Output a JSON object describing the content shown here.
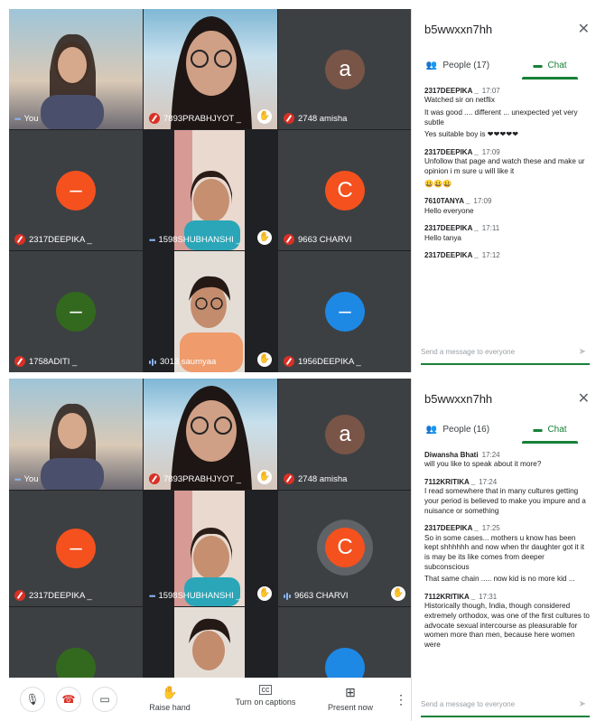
{
  "screen1": {
    "tiles": [
      {
        "name": "You",
        "indicator": "dots"
      },
      {
        "name": "7893PRABHJYOT _",
        "indicator": "mic-off"
      },
      {
        "name": "2748 amisha",
        "indicator": "mic-off",
        "avatar": "a",
        "avatar_color": "#795548"
      },
      {
        "name": "2317DEEPIKA _",
        "indicator": "mic-off",
        "avatar": "–",
        "avatar_color": "#f4511e"
      },
      {
        "name": "1598SHUBHANSHI _",
        "indicator": "dots"
      },
      {
        "name": "9663 CHARVI",
        "indicator": "mic-off",
        "avatar": "C",
        "avatar_color": "#f4511e"
      },
      {
        "name": "1758ADITI _",
        "indicator": "mic-off",
        "avatar": "–",
        "avatar_color": "#33691e"
      },
      {
        "name": "3013 saumyaa",
        "indicator": "bars"
      },
      {
        "name": "1956DEEPIKA _",
        "indicator": "mic-off",
        "avatar": "–",
        "avatar_color": "#1e88e5"
      }
    ],
    "panel": {
      "title": "b5wwxxn7hh",
      "people_tab": "People (17)",
      "chat_tab": "Chat",
      "messages": [
        {
          "sender": "2317DEEPIKA _",
          "time": "17:07",
          "lines": [
            "Watched sir on netflix",
            "It was good .... different ... unexpected yet very subtle",
            "Yes suitable boy is ❤❤❤❤❤"
          ]
        },
        {
          "sender": "2317DEEPIKA _",
          "time": "17:09",
          "lines": [
            "Unfollow that page and watch these and make ur opinion i m sure u will like it",
            "😀😀😀"
          ]
        },
        {
          "sender": "7610TANYA _",
          "time": "17:09",
          "lines": [
            "Hello everyone"
          ]
        },
        {
          "sender": "2317DEEPIKA _",
          "time": "17:11",
          "lines": [
            "Hello tanya"
          ]
        },
        {
          "sender": "2317DEEPIKA _",
          "time": "17:12",
          "lines": []
        }
      ],
      "compose_placeholder": "Send a message to everyone"
    }
  },
  "screen2": {
    "tiles": [
      {
        "name": "You",
        "indicator": "dots"
      },
      {
        "name": "7893PRABHJYOT _",
        "indicator": "mic-off"
      },
      {
        "name": "2748 amisha",
        "indicator": "mic-off",
        "avatar": "a",
        "avatar_color": "#795548"
      },
      {
        "name": "2317DEEPIKA _",
        "indicator": "mic-off",
        "avatar": "–",
        "avatar_color": "#f4511e"
      },
      {
        "name": "1598SHUBHANSHI _",
        "indicator": "dots"
      },
      {
        "name": "9663 CHARVI",
        "indicator": "bars",
        "avatar": "C",
        "avatar_color": "#f4511e"
      }
    ],
    "panel": {
      "title": "b5wwxxn7hh",
      "people_tab": "People (16)",
      "chat_tab": "Chat",
      "messages": [
        {
          "sender": "Diwansha Bhati",
          "time": "17:24",
          "lines": [
            "will you like to speak about it more?"
          ]
        },
        {
          "sender": "7112KRITIKA _",
          "time": "17:24",
          "lines": [
            "I read somewhere that in many cultures getting your period is believed to make you impure and a nuisance or something"
          ]
        },
        {
          "sender": "2317DEEPIKA _",
          "time": "17:25",
          "lines": [
            "So in some cases... mothers u know has been kept shhhhhh and now when thr daughter got it it is may be its like comes from deeper subconscious",
            "That same chain ..... now kid is no more kid ..."
          ]
        },
        {
          "sender": "7112KRITIKA _",
          "time": "17:31",
          "lines": [
            "Historically though, India, though considered extremely orthodox, was one of the first cultures to advocate sexual intercourse as pleasurable for women more than men, because here women were"
          ]
        }
      ],
      "compose_placeholder": "Send a message to everyone"
    },
    "toolbar": {
      "raise_hand": "Raise hand",
      "captions": "Turn on captions",
      "present": "Present now"
    }
  }
}
